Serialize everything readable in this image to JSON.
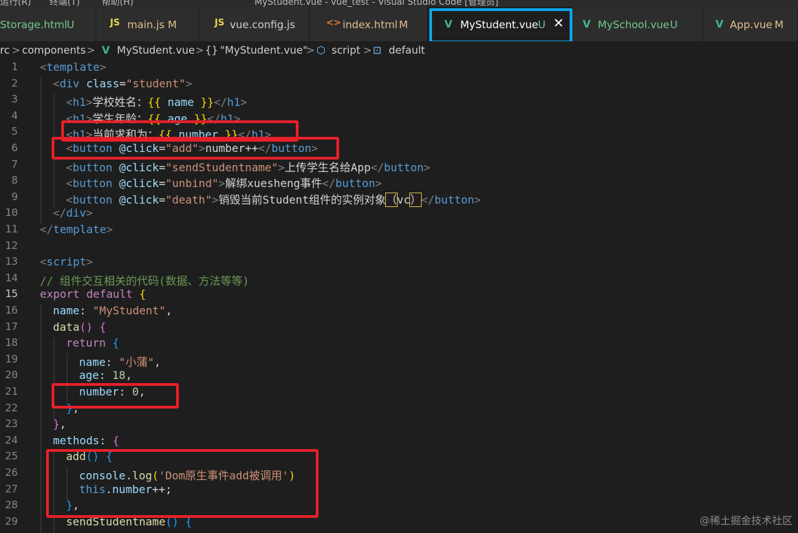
{
  "window": {
    "title_fragment": "MyStudent.vue - vue_test - Visual Studio Code [管理员]",
    "menu_fragments": [
      "运行(R)",
      "终端(T)",
      "帮助(H)"
    ]
  },
  "tabs": [
    {
      "icon": "",
      "label": "Storage.html",
      "status": "U",
      "kind": "untracked"
    },
    {
      "icon": "JS",
      "label": "main.js",
      "status": "M",
      "kind": "modified"
    },
    {
      "icon": "JS",
      "label": "vue.config.js",
      "status": "",
      "kind": "plain"
    },
    {
      "icon": "<>",
      "label": "index.html",
      "status": "M",
      "kind": "modified"
    },
    {
      "icon": "V",
      "label": "MyStudent.vue",
      "status": "U",
      "kind": "untracked",
      "active": true
    },
    {
      "icon": "V",
      "label": "MySchool.vue",
      "status": "U",
      "kind": "untracked"
    },
    {
      "icon": "V",
      "label": "App.vue",
      "status": "M",
      "kind": "modified"
    }
  ],
  "breadcrumb": {
    "items": [
      "rc",
      "components",
      "MyStudent.vue",
      "\"MyStudent.vue\"",
      "script",
      "default"
    ],
    "separator": ">"
  },
  "editor": {
    "current_line": 15,
    "line_numbers": [
      "1",
      "2",
      "3",
      "4",
      "5",
      "6",
      "7",
      "8",
      "9",
      "10",
      "11",
      "12",
      "13",
      "14",
      "15",
      "16",
      "17",
      "18",
      "19",
      "20",
      "21",
      "22",
      "23",
      "24",
      "25",
      "26",
      "27",
      "28",
      "29"
    ],
    "lines": [
      "<template>",
      "<div class=\"student\">",
      "<h1>学校姓名：{{ name }}</h1>",
      "<h1>学生年龄：{{ age }}</h1>",
      "<h1>当前求和为：{{ number }}</h1>",
      "<button @click=\"add\">number++</button>",
      "<button @click=\"sendStudentname\">上传学生名给App</button>",
      "<button @click=\"unbind\">解绑xuesheng事件</button>",
      "<button @click=\"death\">销毁当前Student组件的实例对象（vc）</button>",
      "</div>",
      "</template>",
      "",
      "<script>",
      "// 组件交互相关的代码(数据、方法等等)",
      "export default {",
      "name: \"MyStudent\",",
      "data() {",
      "return {",
      "name: \"小蒲\",",
      "age: 18,",
      "number: 0,",
      "};",
      "},",
      "methods: {",
      "add() {",
      "console.log('Dom原生事件add被调用')",
      "this.number++;",
      "},",
      "sendStudentname() {"
    ]
  },
  "watermark": "@稀土掘金技术社区",
  "colors": {
    "highlight_red": "#e8202a",
    "highlight_blue": "#0ea5e9",
    "editor_bg": "#1e1e1e",
    "vue_green": "#41b883"
  }
}
